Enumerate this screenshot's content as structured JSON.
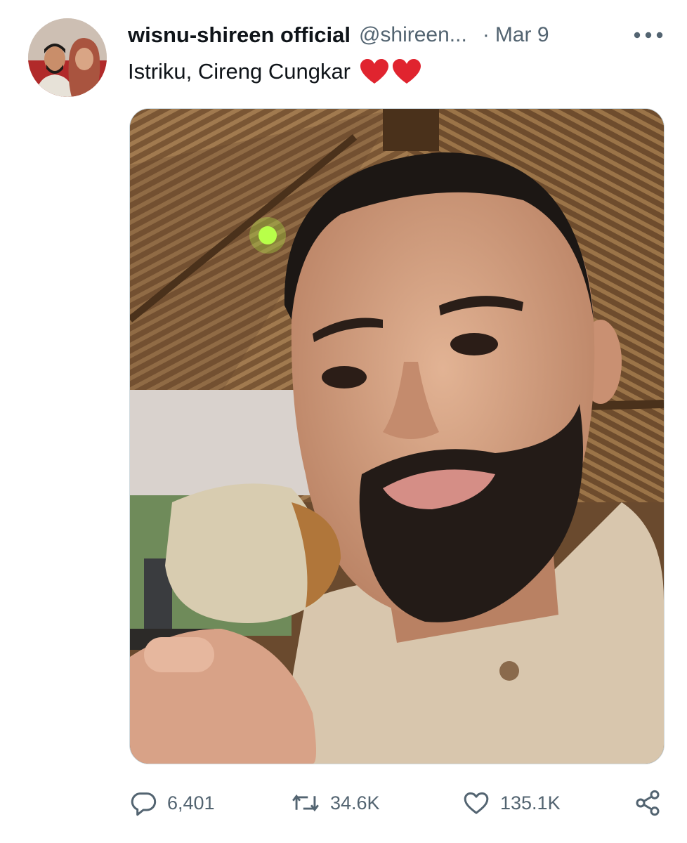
{
  "tweet": {
    "display_name": "wisnu-shireen official",
    "handle": "@shireen...",
    "separator": "·",
    "date": "Mar 9",
    "text": "Istriku, Cireng Cungkar",
    "emoji": [
      "red-heart",
      "red-heart"
    ]
  },
  "actions": {
    "reply_count": "6,401",
    "retweet_count": "34.6K",
    "like_count": "135.1K"
  },
  "colors": {
    "text_primary": "#0f1419",
    "text_secondary": "#536471",
    "heart": "#e0242f"
  },
  "icons": {
    "more": "more-icon",
    "reply": "reply-icon",
    "retweet": "retweet-icon",
    "like": "like-icon",
    "share": "share-icon"
  }
}
